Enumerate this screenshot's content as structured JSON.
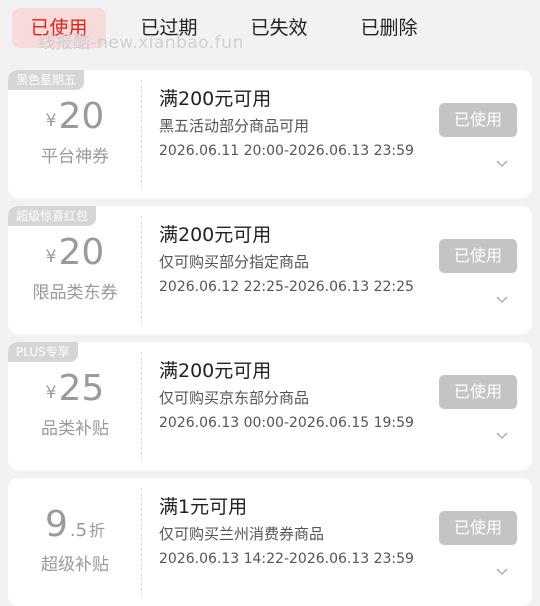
{
  "tabs": [
    {
      "label": "已使用",
      "active": true
    },
    {
      "label": "已过期"
    },
    {
      "label": "已失效"
    },
    {
      "label": "已删除"
    }
  ],
  "watermark": "线报酷-new.xianbao.fun",
  "coupons": [
    {
      "tag": "黑色星期五",
      "currency": "¥",
      "amount": "20",
      "label": "平台神券",
      "title": "满200元可用",
      "desc": "黑五活动部分商品可用",
      "time": "2026.06.11 20:00-2026.06.13 23:59",
      "status": "已使用"
    },
    {
      "tag": "超级惊喜红包",
      "currency": "¥",
      "amount": "20",
      "label": "限品类东券",
      "title": "满200元可用",
      "desc": "仅可购买部分指定商品",
      "time": "2026.06.12 22:25-2026.06.13 22:25",
      "status": "已使用"
    },
    {
      "tag": "PLUS专享",
      "currency": "¥",
      "amount": "25",
      "label": "品类补贴",
      "title": "满200元可用",
      "desc": "仅可购买京东部分商品",
      "time": "2026.06.13 00:00-2026.06.15 19:59",
      "status": "已使用"
    },
    {
      "tag": "",
      "amount_int": "9",
      "amount_dec": ".5",
      "unit": "折",
      "label": "超级补贴",
      "title": "满1元可用",
      "desc": "仅可购买兰州消费券商品",
      "time": "2026.06.13 14:22-2026.06.13 23:59",
      "status": "已使用"
    }
  ]
}
